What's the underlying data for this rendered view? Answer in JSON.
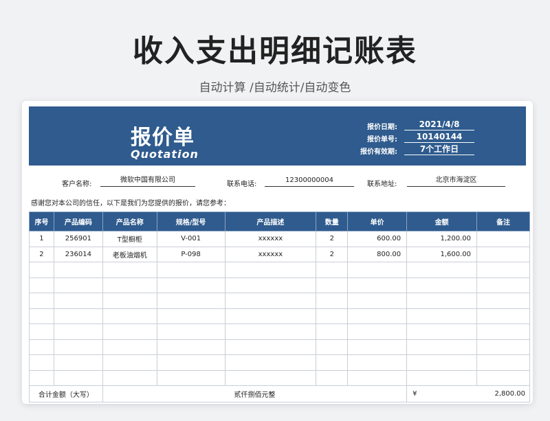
{
  "page": {
    "title": "收入支出明细记账表",
    "subtitle": "自动计算 /自动统计/自动变色"
  },
  "quote": {
    "title_cn": "报价单",
    "title_en": "Quotation",
    "date_label": "报价日期:",
    "date": "2021/4/8",
    "number_label": "报价单号:",
    "number": "10140144",
    "validity_label": "报价有效期:",
    "validity": "7个工作日"
  },
  "client": {
    "name_label": "客户名称:",
    "name": "微软中国有限公司",
    "phone_label": "联系电话:",
    "phone": "12300000004",
    "address_label": "联系地址:",
    "address": "北京市海淀区"
  },
  "thanks_text": "感谢您对本公司的信任，以下是我们为您提供的报价，请您参考：",
  "table": {
    "headers": [
      "序号",
      "产品编码",
      "产品名称",
      "规格/型号",
      "产品描述",
      "数量",
      "单价",
      "金额",
      "备注"
    ],
    "rows": [
      [
        "1",
        "256901",
        "T型橱柜",
        "V-001",
        "xxxxxx",
        "2",
        "600.00",
        "1,200.00",
        ""
      ],
      [
        "2",
        "236014",
        "老板油烟机",
        "P-098",
        "xxxxxx",
        "2",
        "800.00",
        "1,600.00",
        ""
      ]
    ],
    "empty_rows": 8,
    "total_label": "合计金额（大写）",
    "total_words": "贰仟捌佰元整",
    "currency": "¥",
    "total_amount": "2,800.00"
  },
  "colors": {
    "header_bg": "#2f5b8e",
    "page_bg": "#f1f2f4"
  }
}
